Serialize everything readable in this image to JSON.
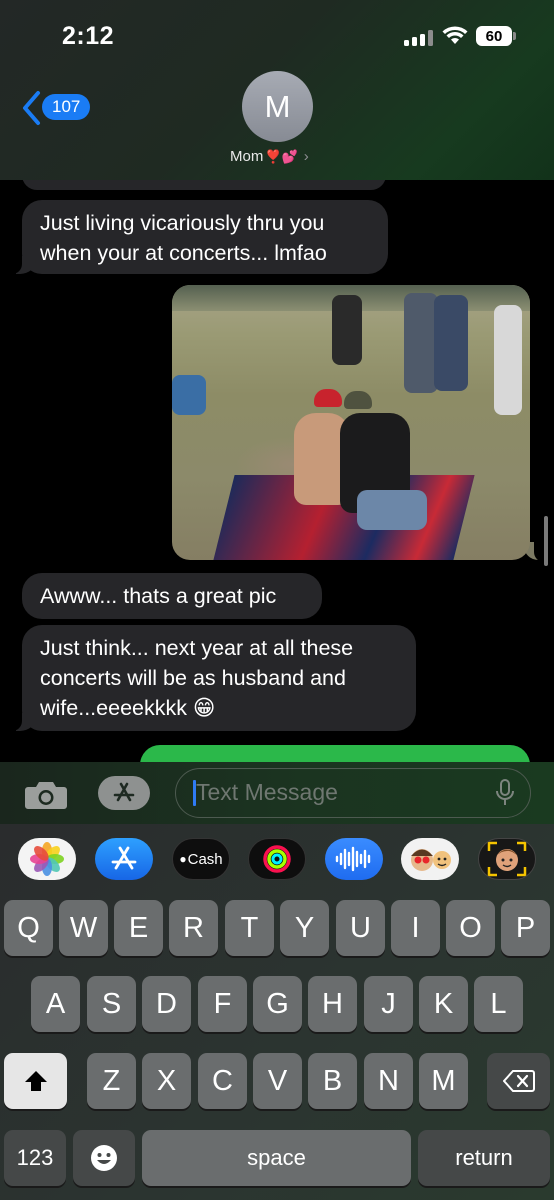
{
  "status_bar": {
    "time": "2:12",
    "battery": "60"
  },
  "header": {
    "back_count": "107",
    "avatar_initial": "M",
    "contact_name": "Mom",
    "contact_emoji": "❣️💕"
  },
  "messages": [
    {
      "direction": "received",
      "text_lines": [
        "Just living vicariously thru you",
        "when your at concerts... lmfao"
      ]
    },
    {
      "direction": "sent",
      "type": "photo"
    },
    {
      "direction": "received",
      "text_lines": [
        "Awww... thats a great pic"
      ]
    },
    {
      "direction": "received",
      "text_lines": [
        "Just think... next year at all these",
        "concerts will be as husband and",
        "wife...eeeekkkk 😁"
      ]
    }
  ],
  "compose": {
    "placeholder": "Text Message"
  },
  "app_drawer": [
    "photos",
    "app-store",
    "apple-cash",
    "activity",
    "audio-message",
    "memoji-stickers",
    "memoji"
  ],
  "app_drawer_labels": {
    "apple_cash": "Cash"
  },
  "keyboard": {
    "row1": [
      "Q",
      "W",
      "E",
      "R",
      "T",
      "Y",
      "U",
      "I",
      "O",
      "P"
    ],
    "row2": [
      "A",
      "S",
      "D",
      "F",
      "G",
      "H",
      "J",
      "K",
      "L"
    ],
    "row3": [
      "Z",
      "X",
      "C",
      "V",
      "B",
      "N",
      "M"
    ],
    "numbers_key": "123",
    "space_key": "space",
    "return_key": "return"
  },
  "colors": {
    "imessage_blue": "#1a7cf5",
    "received_bubble": "#262629",
    "sent_bubble": "#2bb84a"
  }
}
